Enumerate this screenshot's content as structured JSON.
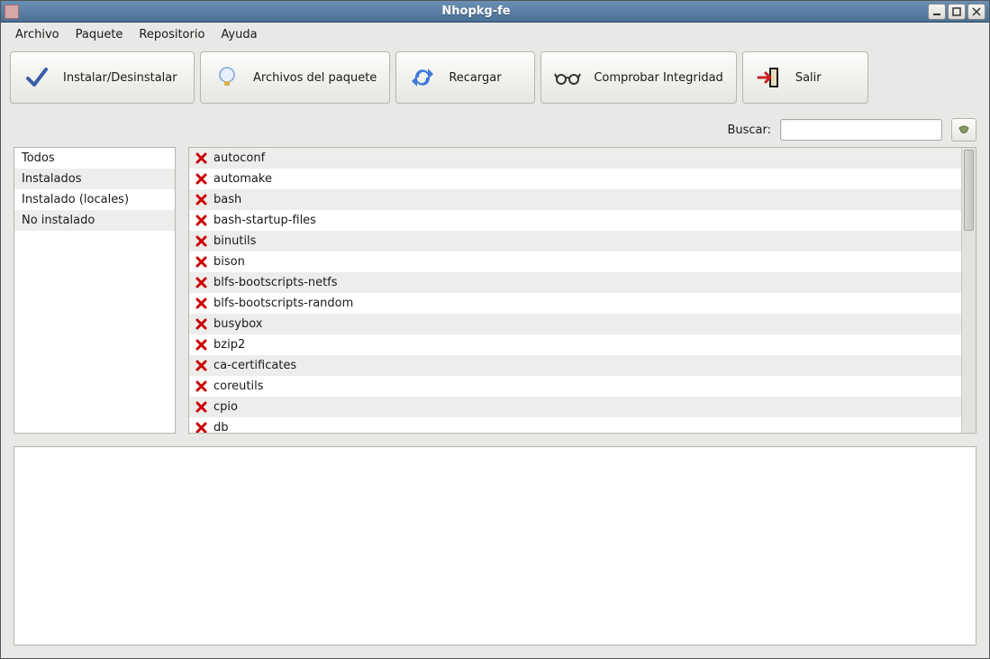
{
  "window": {
    "title": "Nhopkg-fe"
  },
  "menubar": {
    "items": [
      "Archivo",
      "Paquete",
      "Repositorio",
      "Ayuda"
    ]
  },
  "toolbar": {
    "install_label": "Instalar/Desinstalar",
    "files_label": "Archivos del paquete",
    "reload_label": "Recargar",
    "integrity_label": "Comprobar Integridad",
    "exit_label": "Salir"
  },
  "search": {
    "label": "Buscar:",
    "value": ""
  },
  "sidebar": {
    "items": [
      {
        "label": "Todos"
      },
      {
        "label": "Instalados"
      },
      {
        "label": "Instalado (locales)"
      },
      {
        "label": "No instalado"
      }
    ]
  },
  "packages": [
    {
      "name": "autoconf",
      "status": "not-installed"
    },
    {
      "name": "automake",
      "status": "not-installed"
    },
    {
      "name": "bash",
      "status": "not-installed"
    },
    {
      "name": "bash-startup-files",
      "status": "not-installed"
    },
    {
      "name": "binutils",
      "status": "not-installed"
    },
    {
      "name": "bison",
      "status": "not-installed"
    },
    {
      "name": "blfs-bootscripts-netfs",
      "status": "not-installed"
    },
    {
      "name": "blfs-bootscripts-random",
      "status": "not-installed"
    },
    {
      "name": "busybox",
      "status": "not-installed"
    },
    {
      "name": "bzip2",
      "status": "not-installed"
    },
    {
      "name": "ca-certificates",
      "status": "not-installed"
    },
    {
      "name": "coreutils",
      "status": "not-installed"
    },
    {
      "name": "cpio",
      "status": "not-installed"
    },
    {
      "name": "db",
      "status": "not-installed"
    }
  ]
}
